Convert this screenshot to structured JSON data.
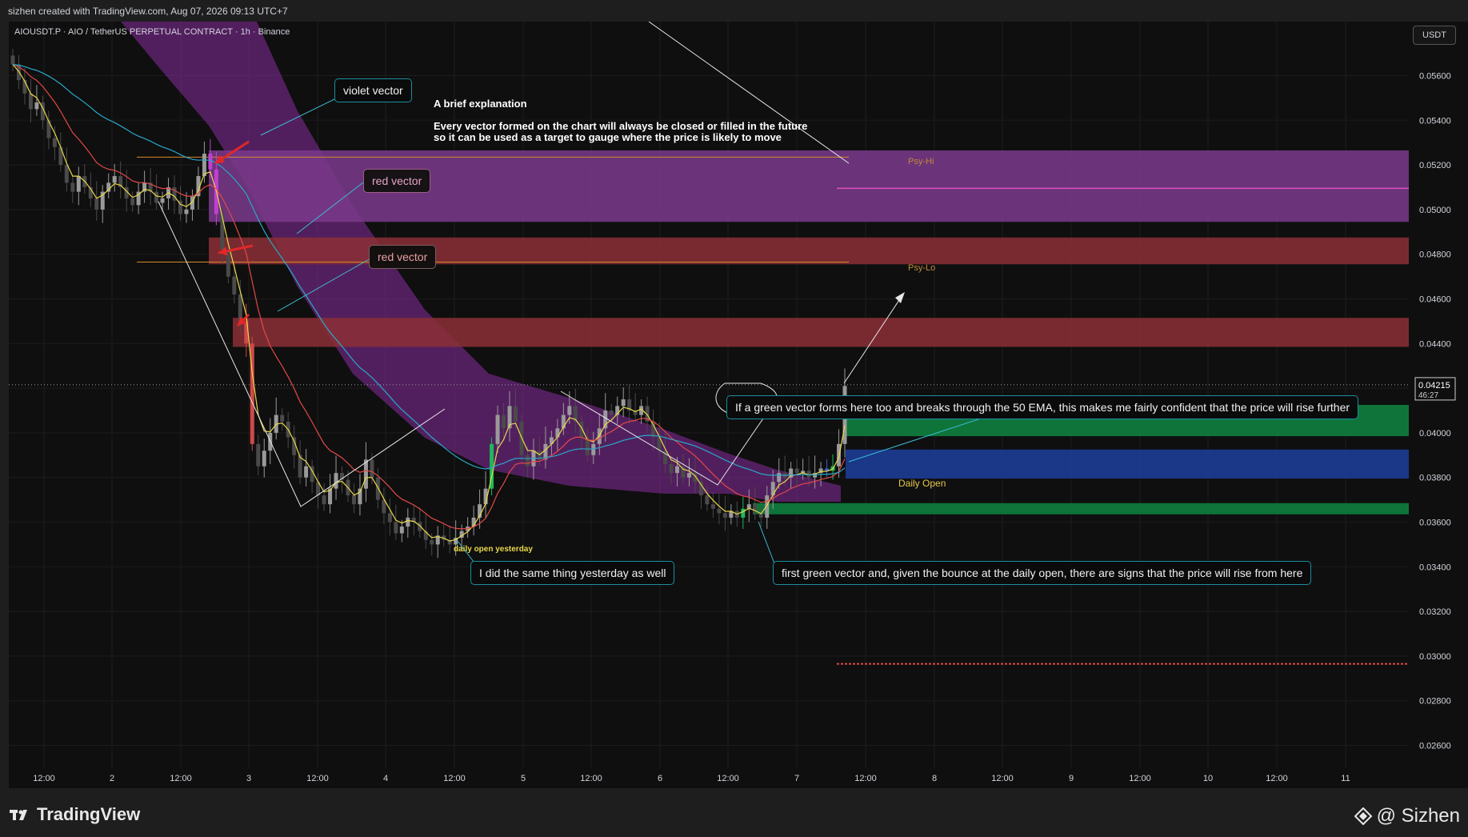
{
  "header": {
    "credit": "sizhen created with TradingView.com, Aug 07, 2026 09:13 UTC+7",
    "symbol": "AIOUSDT.P · AIO / TetherUS PERPETUAL CONTRACT · 1h · Binance",
    "currency": "USDT"
  },
  "footer": {
    "logo_text": "TradingView",
    "author": "@ Sizhen"
  },
  "price_badge": {
    "price": "0.04215",
    "countdown": "46:27"
  },
  "annotations": {
    "title": "A brief explanation",
    "body_line1": "Every vector formed on the chart will always be closed or filled in the future",
    "body_line2": "so it can be used as a target to gauge where the price is likely to move",
    "violet_vector": "violet vector",
    "red_vector_1": "red vector",
    "red_vector_2": "red vector",
    "green_callout": "If a green vector forms here too and breaks through the 50 EMA, this makes me fairly confident that the price will rise further",
    "yesterday_callout": "I did the same thing yesterday as well",
    "first_green_callout": "first green vector and, given the bounce at the daily open, there are signs that the price will rise from here",
    "daily_open_yesterday": "daily open yesterday",
    "daily_open": "Daily Open",
    "psy_hi": "Psy-Hi",
    "psy_lo": "Psy-Lo"
  },
  "colors": {
    "background": "#0f0f0f",
    "violet_zone": "#7b3a8c",
    "red_zone": "#8b2f36",
    "green_zone": "#0f7a3d",
    "blue_zone": "#1c3a8f",
    "ema_band": "#8a2ea0",
    "ema_fast": "#e8d84a",
    "ema_mid": "#e34848",
    "ema_slow": "#2aa7c8"
  },
  "chart_data": {
    "type": "candlestick",
    "y_axis": {
      "ticks": [
        "0.05600",
        "0.05400",
        "0.05200",
        "0.05000",
        "0.04800",
        "0.04600",
        "0.04400",
        "0.04200",
        "0.04000",
        "0.03800",
        "0.03600",
        "0.03400",
        "0.03200",
        "0.03000",
        "0.02800",
        "0.02600"
      ],
      "range": [
        0.0255,
        0.0585
      ]
    },
    "x_axis": {
      "ticks": [
        "12:00",
        "2",
        "12:00",
        "3",
        "12:00",
        "4",
        "12:00",
        "5",
        "12:00",
        "6",
        "12:00",
        "7",
        "12:00",
        "8",
        "12:00",
        "9",
        "12:00",
        "10",
        "12:00",
        "11"
      ]
    },
    "last_price": 0.04215,
    "zones": [
      {
        "name": "violet vector zone",
        "from": 0.04945,
        "to": 0.05265
      },
      {
        "name": "red vector zone 1",
        "from": 0.04755,
        "to": 0.04875
      },
      {
        "name": "red vector zone 2",
        "from": 0.04385,
        "to": 0.04515
      },
      {
        "name": "green vector zone",
        "from": 0.03985,
        "to": 0.04125
      },
      {
        "name": "daily open zone",
        "from": 0.03795,
        "to": 0.03925
      },
      {
        "name": "first green vector zone",
        "from": 0.03635,
        "to": 0.03685
      }
    ],
    "levels": [
      {
        "name": "psy-hi",
        "value": 0.05235
      },
      {
        "name": "psy-lo",
        "value": 0.04765
      },
      {
        "name": "pink level",
        "value": 0.05095
      },
      {
        "name": "red dashed level",
        "value": 0.02965
      }
    ],
    "close_series": [
      0.0565,
      0.0558,
      0.0552,
      0.0545,
      0.0548,
      0.054,
      0.0532,
      0.0528,
      0.052,
      0.0512,
      0.0508,
      0.0515,
      0.051,
      0.0505,
      0.05,
      0.0508,
      0.0512,
      0.0515,
      0.051,
      0.0505,
      0.0502,
      0.0508,
      0.0512,
      0.0508,
      0.0503,
      0.0505,
      0.051,
      0.0504,
      0.0498,
      0.05,
      0.0506,
      0.0515,
      0.0525,
      0.0518,
      0.0498,
      0.0482,
      0.047,
      0.0462,
      0.045,
      0.044,
      0.0395,
      0.0385,
      0.0392,
      0.04,
      0.0408,
      0.0405,
      0.0398,
      0.039,
      0.038,
      0.0385,
      0.0378,
      0.0372,
      0.0368,
      0.0375,
      0.0382,
      0.0379,
      0.0372,
      0.0368,
      0.0375,
      0.0388,
      0.038,
      0.037,
      0.0364,
      0.036,
      0.0355,
      0.0358,
      0.0362,
      0.036,
      0.0356,
      0.0352,
      0.035,
      0.0354,
      0.0352,
      0.035,
      0.0353,
      0.0356,
      0.0358,
      0.0362,
      0.0368,
      0.0375,
      0.0395,
      0.0408,
      0.0402,
      0.0412,
      0.0405,
      0.039,
      0.0385,
      0.0392,
      0.0388,
      0.0395,
      0.0398,
      0.0402,
      0.0408,
      0.0412,
      0.0405,
      0.0398,
      0.039,
      0.0395,
      0.0402,
      0.041,
      0.0408,
      0.0412,
      0.0415,
      0.041,
      0.0408,
      0.0412,
      0.0405,
      0.0398,
      0.0392,
      0.0386,
      0.0382,
      0.0385,
      0.038,
      0.0382,
      0.0378,
      0.0372,
      0.0368,
      0.0366,
      0.0364,
      0.0362,
      0.0365,
      0.0362,
      0.0366,
      0.0368,
      0.0364,
      0.0362,
      0.0372,
      0.0378,
      0.0382,
      0.038,
      0.0384,
      0.0382,
      0.0383,
      0.038,
      0.0382,
      0.0384,
      0.0383,
      0.0385,
      0.0395,
      0.0421
    ]
  }
}
